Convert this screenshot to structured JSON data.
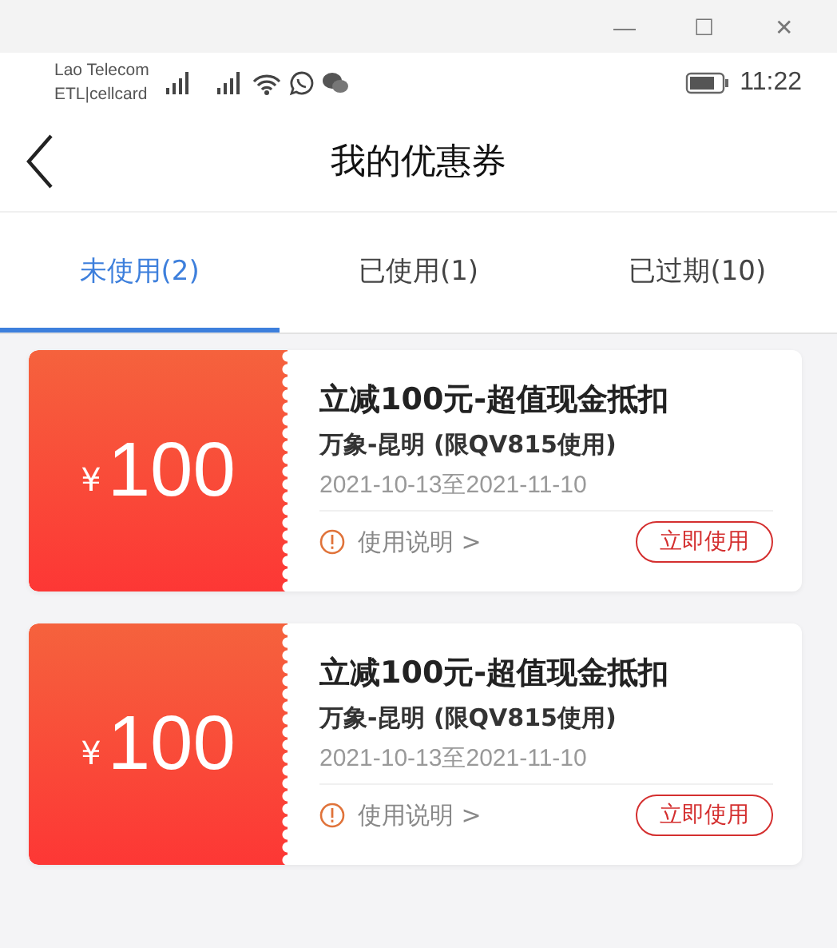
{
  "window": {
    "controls": [
      "—",
      "☐",
      "✕"
    ]
  },
  "status_bar": {
    "carrier_lines": [
      "Lao Telecom",
      "ETL|cellcard"
    ],
    "time": "11:22"
  },
  "header": {
    "title": "我的优惠券"
  },
  "tabs": [
    {
      "label": "未使用(2)",
      "selected": true
    },
    {
      "label": "已使用(1)",
      "selected": false
    },
    {
      "label": "已过期(10)",
      "selected": false
    }
  ],
  "coupons": [
    {
      "currency": "¥",
      "amount": "100",
      "title": "立减100元-超值现金抵扣",
      "route": "万象-昆明 (限QV815使用)",
      "validity": "2021-10-13至2021-11-10",
      "info": "使用说明 >",
      "action": "立即使用"
    },
    {
      "currency": "¥",
      "amount": "100",
      "title": "立减100元-超值现金抵扣",
      "route": "万象-昆明 (限QV815使用)",
      "validity": "2021-10-13至2021-11-10",
      "info": "使用说明 >",
      "action": "立即使用"
    }
  ]
}
